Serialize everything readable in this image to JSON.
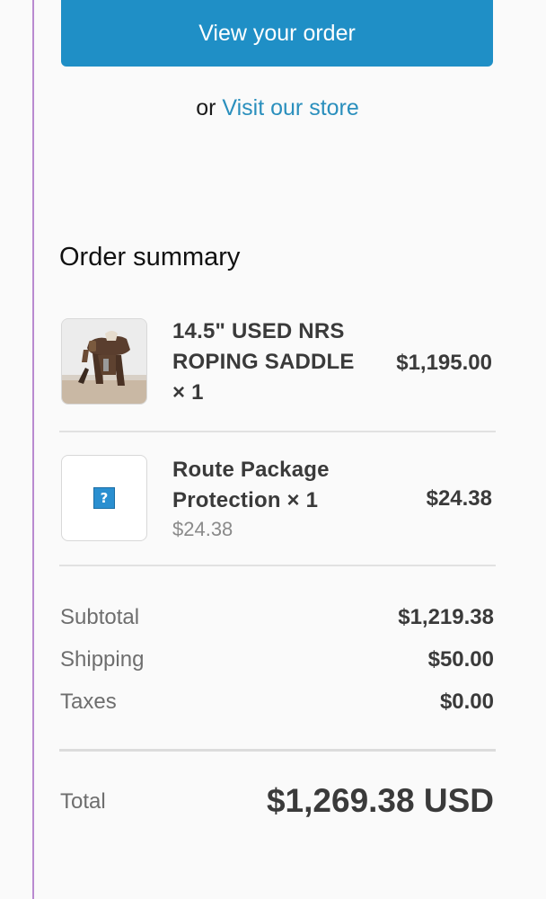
{
  "actions": {
    "view_order_label": "View your order",
    "or_text": "or",
    "visit_store_label": "Visit our store"
  },
  "summary": {
    "title": "Order summary",
    "items": [
      {
        "name": "14.5\" USED NRS ROPING SADDLE × 1",
        "price": "$1,195.00",
        "image_icon": "saddle-image"
      },
      {
        "name": "Route Package Protection × 1",
        "unit_price": "$24.38",
        "price": "$24.38",
        "image_icon": "missing-image-icon"
      }
    ],
    "rows": [
      {
        "label": "Subtotal",
        "value": "$1,219.38"
      },
      {
        "label": "Shipping",
        "value": "$50.00"
      },
      {
        "label": "Taxes",
        "value": "$0.00"
      }
    ],
    "total_label": "Total",
    "total_value": "$1,269.38 USD"
  },
  "colors": {
    "button": "#1f8fc6",
    "link": "#2a8fbd",
    "accent_rule": "#b98ad0"
  }
}
